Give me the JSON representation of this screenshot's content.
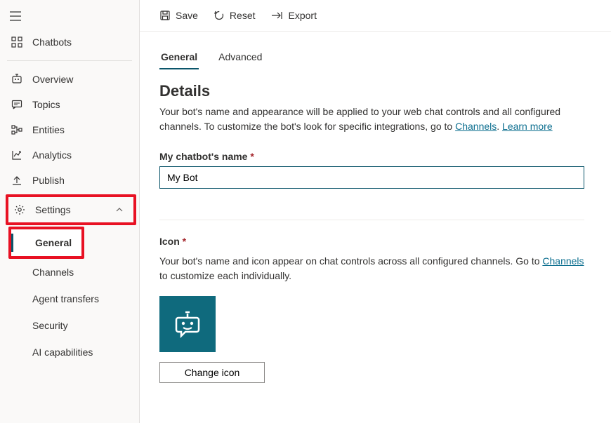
{
  "cmdbar": {
    "save": "Save",
    "reset": "Reset",
    "export": "Export"
  },
  "sidebar": {
    "chatbots": "Chatbots",
    "items": [
      {
        "label": "Overview"
      },
      {
        "label": "Topics"
      },
      {
        "label": "Entities"
      },
      {
        "label": "Analytics"
      },
      {
        "label": "Publish"
      },
      {
        "label": "Settings"
      }
    ],
    "settings_children": [
      {
        "label": "General"
      },
      {
        "label": "Channels"
      },
      {
        "label": "Agent transfers"
      },
      {
        "label": "Security"
      },
      {
        "label": "AI capabilities"
      }
    ]
  },
  "tabs": {
    "general": "General",
    "advanced": "Advanced"
  },
  "details": {
    "heading": "Details",
    "desc_a": "Your bot's name and appearance will be applied to your web chat controls and all configured channels. To customize the bot's look for specific integrations, go to ",
    "link_channels": "Channels",
    "sep": ". ",
    "link_learn": "Learn more",
    "name_label": "My chatbot's name",
    "name_value": "My Bot",
    "icon_label": "Icon",
    "icon_desc_a": "Your bot's name and icon appear on chat controls across all configured channels. Go to ",
    "icon_desc_b": " to customize each individually.",
    "change_icon": "Change icon"
  }
}
